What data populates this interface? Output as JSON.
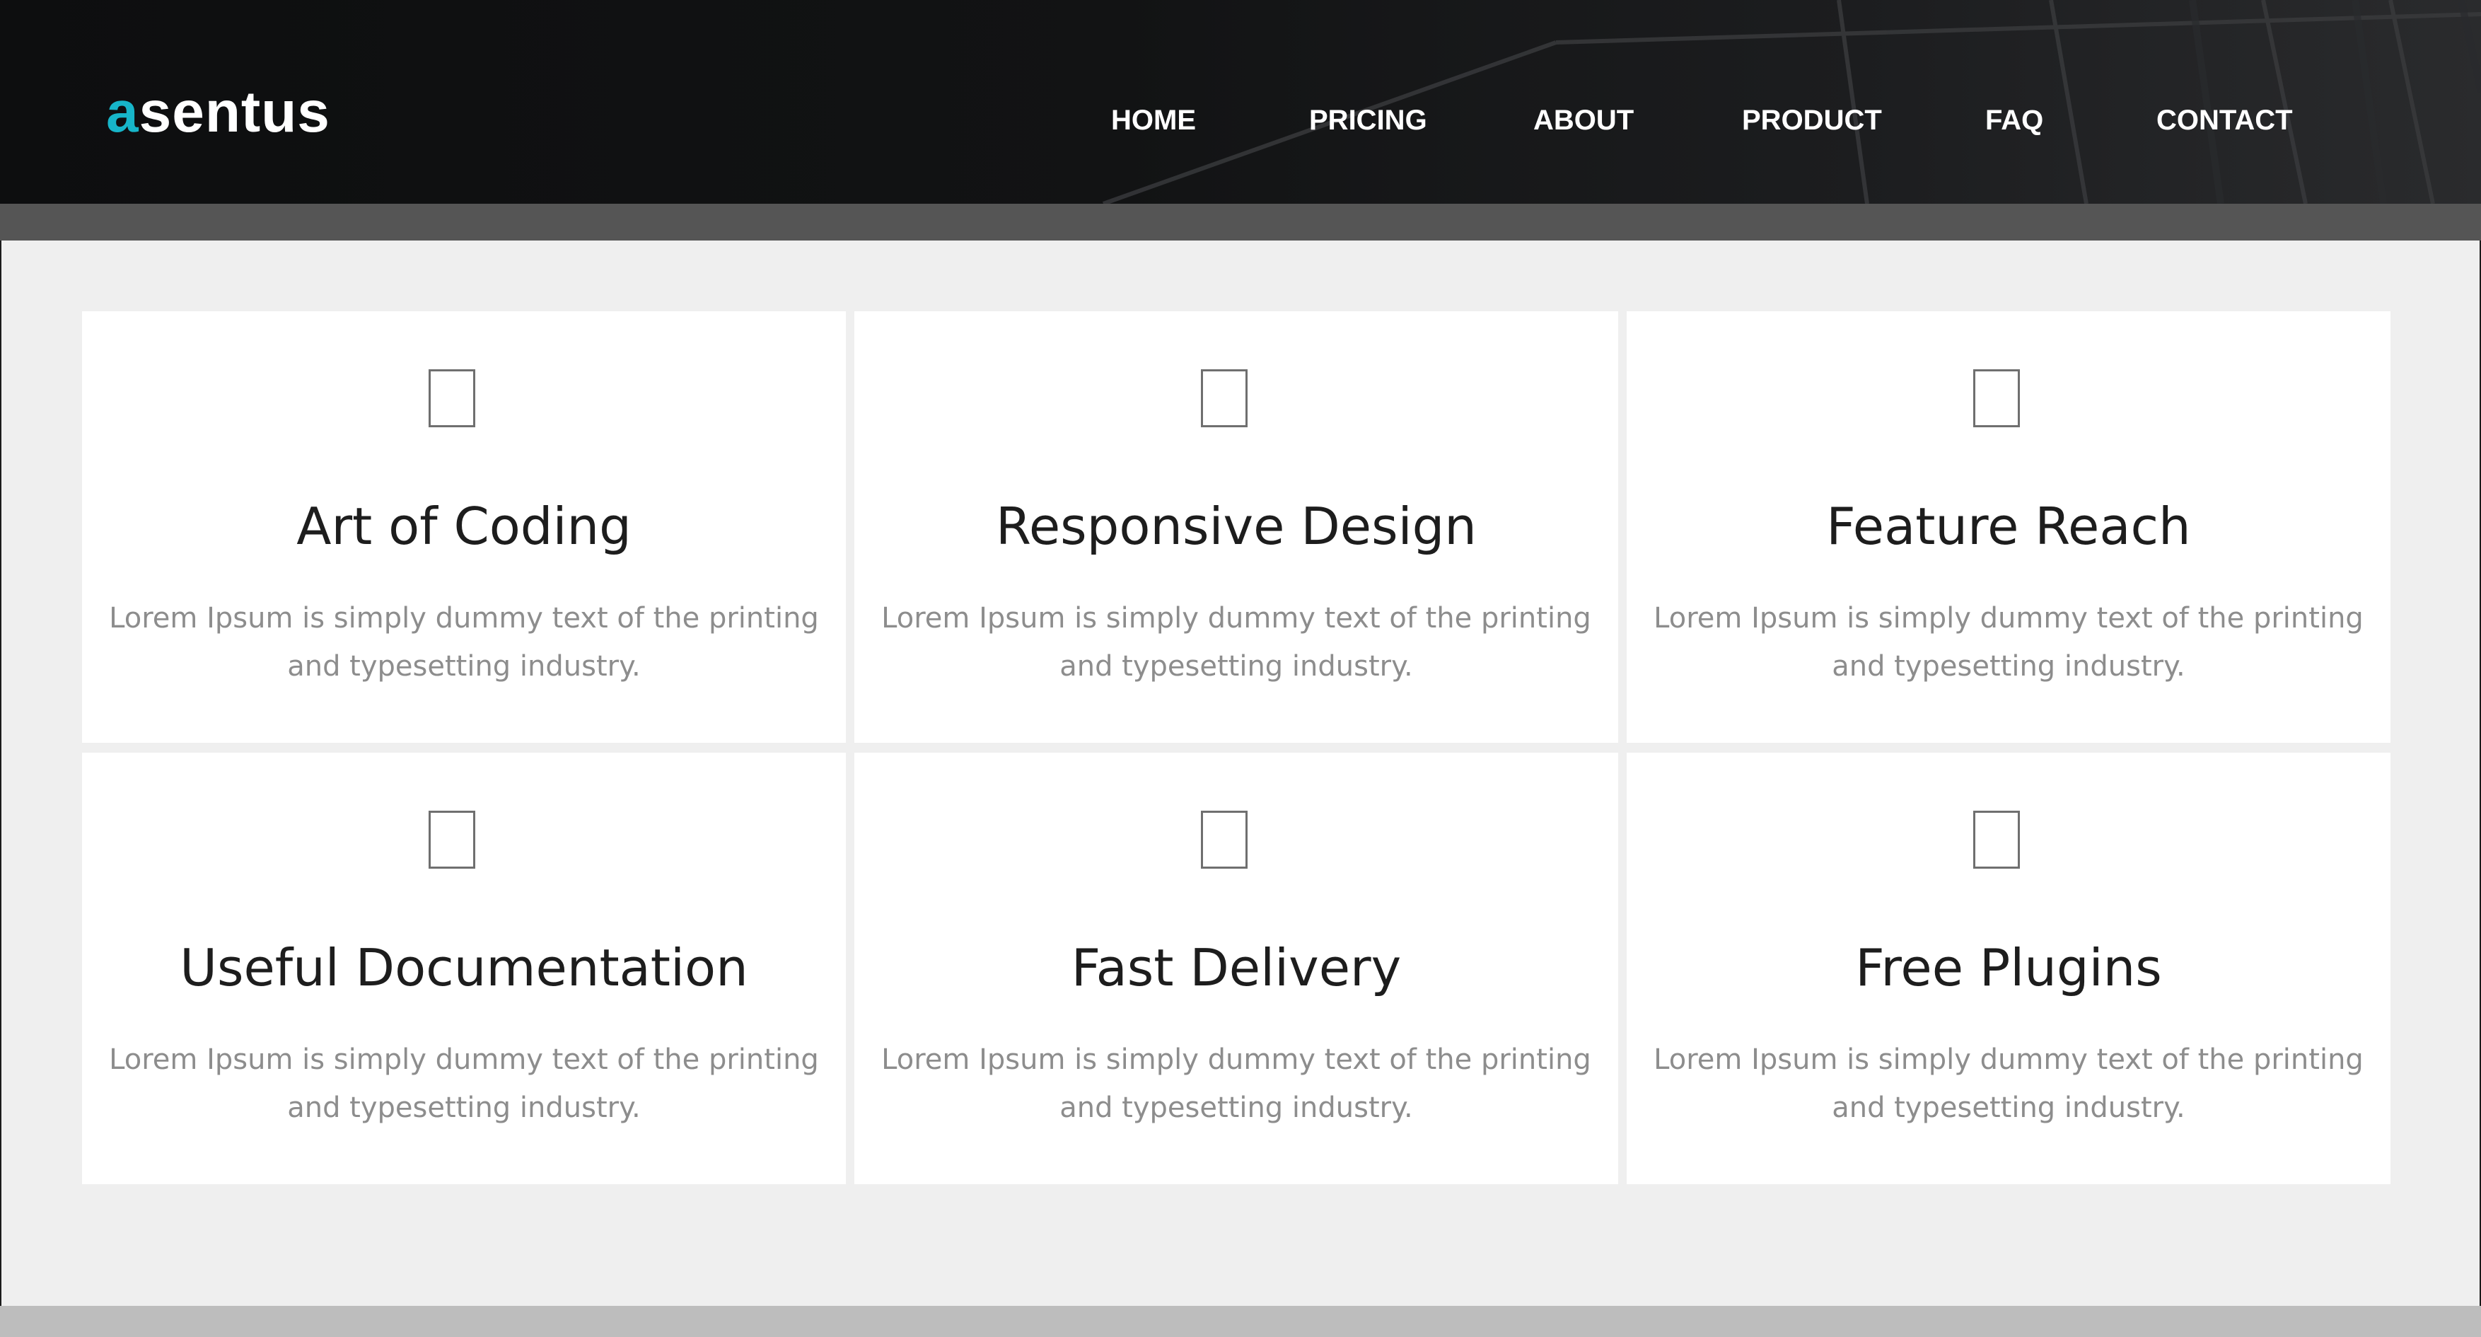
{
  "brand": {
    "logo_accent": "a",
    "logo_rest": "sentus",
    "accent_color": "#17b5c9"
  },
  "nav": {
    "items": [
      {
        "label": "HOME"
      },
      {
        "label": "PRICING"
      },
      {
        "label": "ABOUT"
      },
      {
        "label": "PRODUCT"
      },
      {
        "label": "FAQ"
      },
      {
        "label": "CONTACT"
      }
    ]
  },
  "features": [
    {
      "icon": "placeholder-box-icon",
      "title": "Art of Coding",
      "description": "Lorem Ipsum is simply dummy text of the printing and typesetting industry."
    },
    {
      "icon": "placeholder-box-icon",
      "title": "Responsive Design",
      "description": "Lorem Ipsum is simply dummy text of the printing and typesetting industry."
    },
    {
      "icon": "placeholder-box-icon",
      "title": "Feature Reach",
      "description": "Lorem Ipsum is simply dummy text of the printing and typesetting industry."
    },
    {
      "icon": "placeholder-box-icon",
      "title": "Useful Documentation",
      "description": "Lorem Ipsum is simply dummy text of the printing and typesetting industry."
    },
    {
      "icon": "placeholder-box-icon",
      "title": "Fast Delivery",
      "description": "Lorem Ipsum is simply dummy text of the printing and typesetting industry."
    },
    {
      "icon": "placeholder-box-icon",
      "title": "Free Plugins",
      "description": "Lorem Ipsum is simply dummy text of the printing and typesetting industry."
    }
  ]
}
